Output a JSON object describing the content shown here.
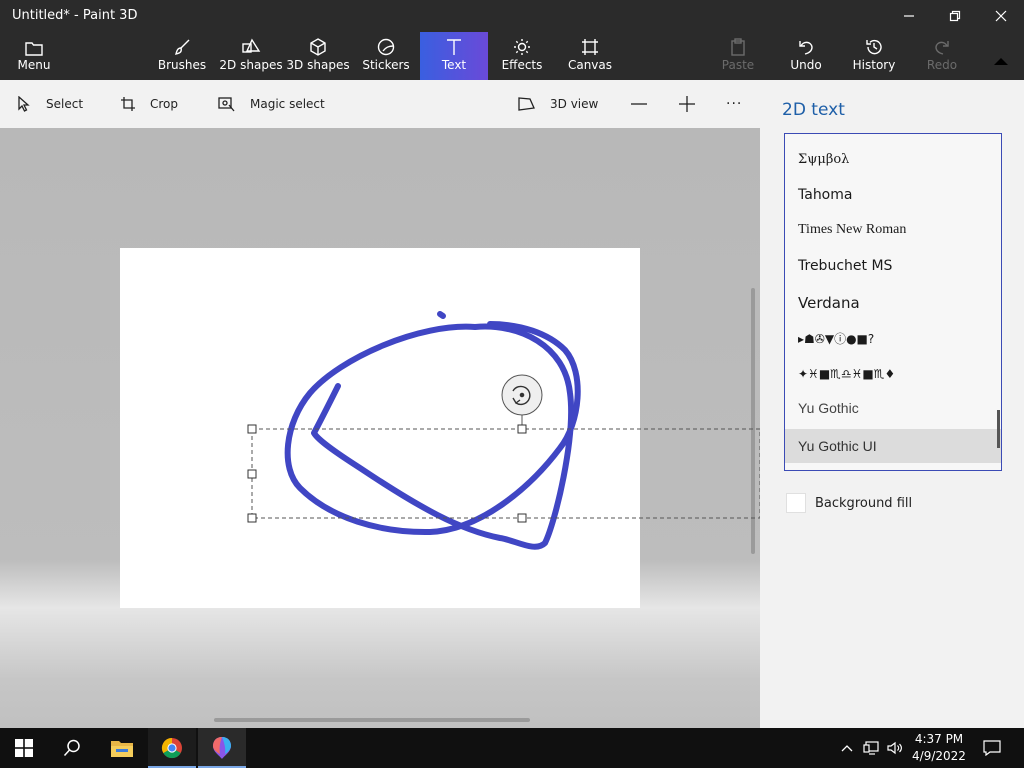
{
  "window": {
    "title": "Untitled* - Paint 3D"
  },
  "ribbon": {
    "menu": "Menu",
    "brushes": "Brushes",
    "shapes2d": "2D shapes",
    "shapes3d": "3D shapes",
    "stickers": "Stickers",
    "text": "Text",
    "effects": "Effects",
    "canvas": "Canvas",
    "paste": "Paste",
    "undo": "Undo",
    "history": "History",
    "redo": "Redo"
  },
  "toolbar": {
    "select": "Select",
    "crop": "Crop",
    "magic_select": "Magic select",
    "view3d": "3D view",
    "more": "···"
  },
  "panel": {
    "title": "2D text",
    "fonts": [
      "Σψμβολ",
      "Tahoma",
      "Times New Roman",
      "Trebuchet MS",
      "Verdana",
      "▸☗✇▼ⓘ●■?",
      "✦♓■♏♎♓■♏♦",
      "Yu Gothic",
      "Yu Gothic UI"
    ],
    "selected_font": "Yu Gothic UI",
    "background_fill": "Background fill"
  },
  "drawing": {
    "stroke_color": "#4046c4"
  },
  "taskbar": {
    "time": "4:37 PM",
    "date": "4/9/2022"
  },
  "colors": {
    "accent": "#3a5fe0",
    "title_accent": "#1e5fa8"
  }
}
